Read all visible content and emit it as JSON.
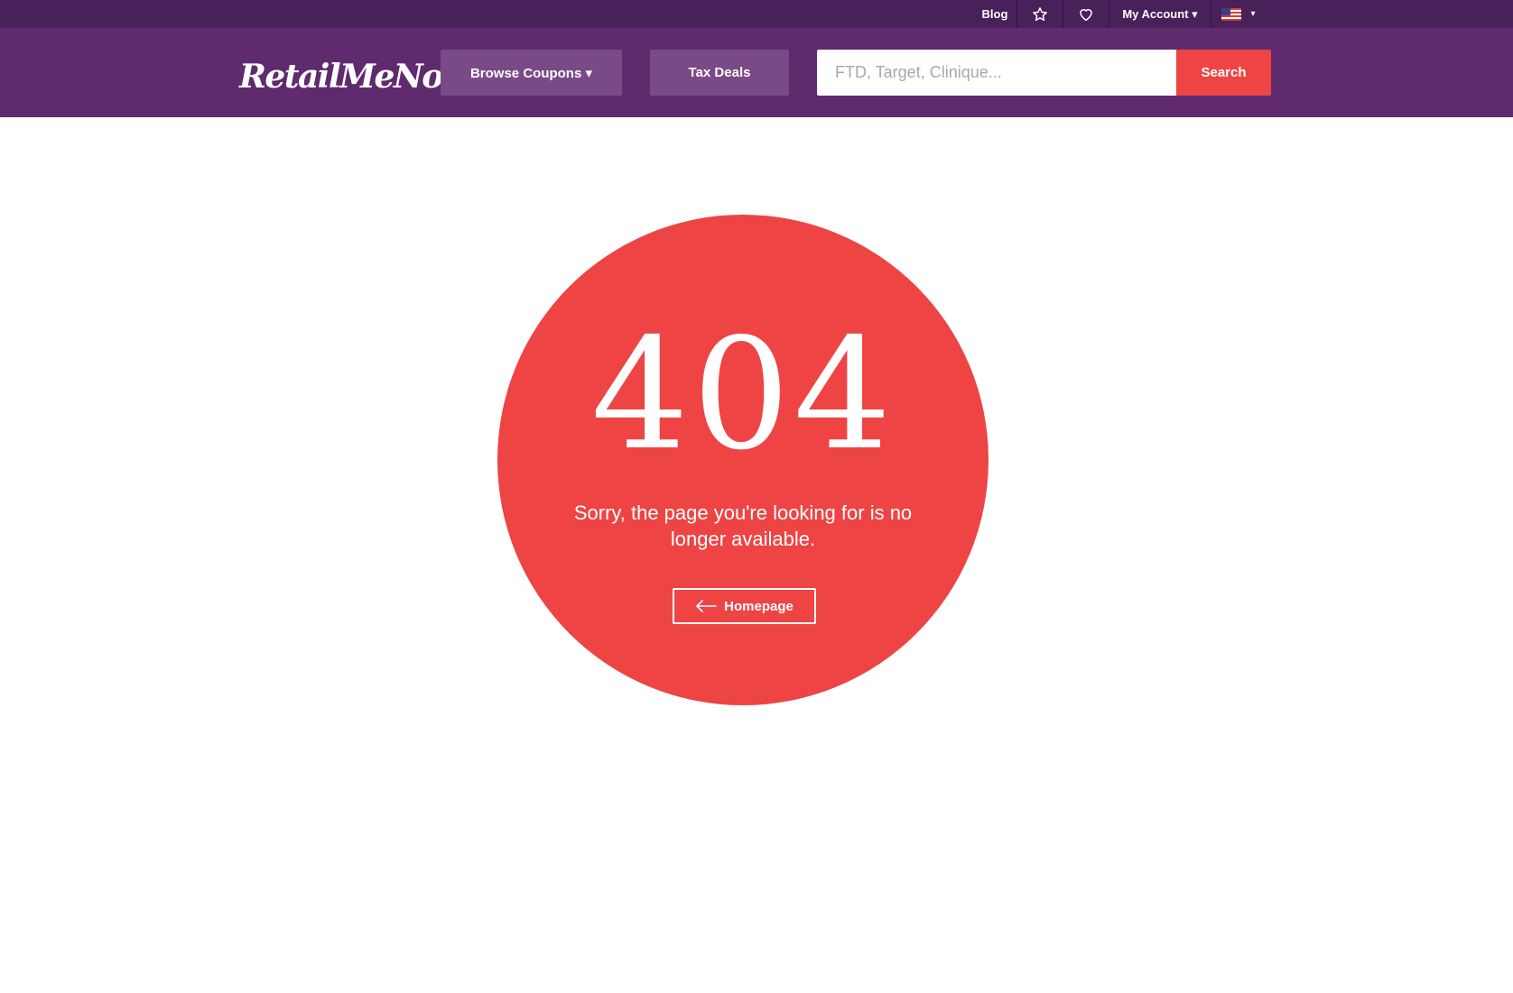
{
  "topbar": {
    "blog_label": "Blog",
    "account_label": "My Account ▾",
    "star_icon": "star-icon",
    "heart_icon": "heart-icon",
    "flag_icon": "us-flag-icon",
    "flag_caret": "▾"
  },
  "header": {
    "logo_text": "RetailMeNot",
    "browse_label": "Browse Coupons ▾",
    "tax_label": "Tax Deals",
    "search_placeholder": "FTD, Target, Clinique...",
    "search_button": "Search"
  },
  "error": {
    "code": "404",
    "message": "Sorry, the page you're looking for is no longer available.",
    "home_button": "Homepage",
    "home_icon": "arrow-left-icon"
  },
  "colors": {
    "topbar": "#48205a",
    "header": "#5f2a6e",
    "nav_button": "#7a4a86",
    "accent": "#ee4444"
  }
}
